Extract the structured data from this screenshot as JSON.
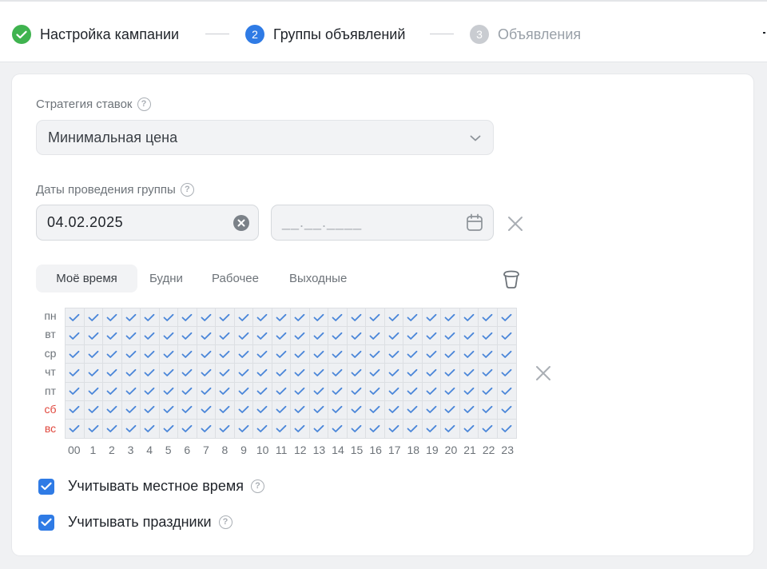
{
  "stepper": {
    "steps": [
      {
        "number": "✓",
        "label": "Настройка кампании",
        "state": "done"
      },
      {
        "number": "2",
        "label": "Группы объявлений",
        "state": "active"
      },
      {
        "number": "3",
        "label": "Объявления",
        "state": "pending"
      }
    ]
  },
  "form": {
    "bid_strategy": {
      "label": "Стратегия ставок",
      "value": "Минимальная цена",
      "help_icon": "question-circle-icon"
    },
    "dates": {
      "label": "Даты проведения группы",
      "start_value": "04.02.2025",
      "end_placeholder": "__.__.____",
      "help_icon": "question-circle-icon"
    },
    "schedule": {
      "presets": [
        "Моё время",
        "Будни",
        "Рабочее",
        "Выходные"
      ],
      "active_preset": "Моё время",
      "days": [
        "пн",
        "вт",
        "ср",
        "чт",
        "пт",
        "сб",
        "вс"
      ],
      "weekend_days": [
        "сб",
        "вс"
      ],
      "hours": [
        "00",
        "1",
        "2",
        "3",
        "4",
        "5",
        "6",
        "7",
        "8",
        "9",
        "10",
        "11",
        "12",
        "13",
        "14",
        "15",
        "16",
        "17",
        "18",
        "19",
        "20",
        "21",
        "22",
        "23"
      ],
      "all_selected": true
    },
    "options": [
      {
        "label": "Учитывать местное время",
        "checked": true
      },
      {
        "label": "Учитывать праздники",
        "checked": true
      }
    ]
  },
  "colors": {
    "accent": "#2f7be5",
    "done": "#3fb34f",
    "weekend": "#e0473d",
    "check": "#4a86d9"
  }
}
